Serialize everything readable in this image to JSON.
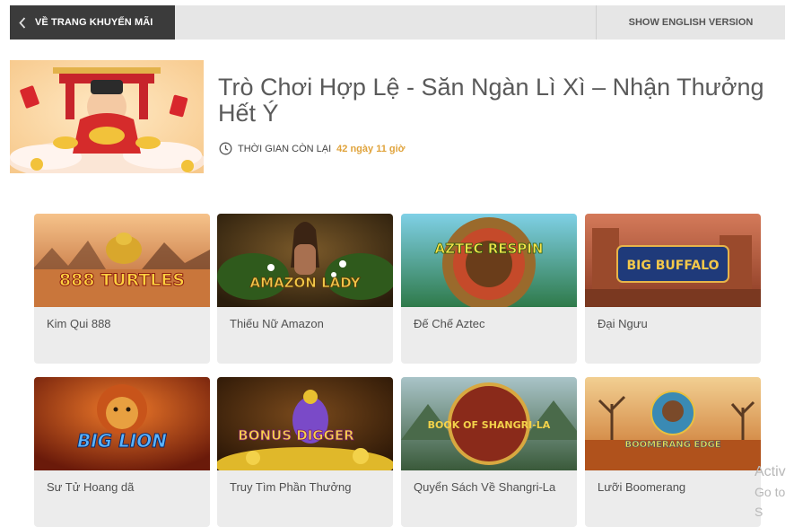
{
  "topbar": {
    "back_label": "VỀ TRANG KHUYẾN MÃI",
    "lang_label": "SHOW ENGLISH VERSION"
  },
  "promo": {
    "title": "Trò Chơi Hợp Lệ - Săn Ngàn Lì Xì – Nhận Thưởng Hết Ý",
    "timer_label": "THỜI GIAN CÒN LẠI",
    "timer_value": "42 ngày 11 giờ"
  },
  "games": [
    {
      "name": "Kim Qui 888",
      "logo": "888 TURTLES"
    },
    {
      "name": "Thiếu Nữ Amazon",
      "logo": "AMAZON LADY"
    },
    {
      "name": "Đế Chế Aztec",
      "logo": "AZTEC RESPIN"
    },
    {
      "name": "Đại Ngưu",
      "logo": "BIG BUFFALO"
    },
    {
      "name": "Sư Tử Hoang dã",
      "logo": "BIG LION"
    },
    {
      "name": "Truy Tìm Phần Thưởng",
      "logo": "BONUS DIGGER"
    },
    {
      "name": "Quyển Sách Về Shangri-La",
      "logo": "BOOK OF SHANGRI-LA"
    },
    {
      "name": "Lưỡi Boomerang",
      "logo": "BOOMERANG EDGE"
    }
  ],
  "watermark": {
    "line1": "Activ",
    "line2": "Go to S"
  },
  "colors": {
    "topbar_bg": "#e6e6e6",
    "back_bg": "#3b3b3b",
    "timer_value": "#e0a33b",
    "card_bg": "#ececec"
  }
}
